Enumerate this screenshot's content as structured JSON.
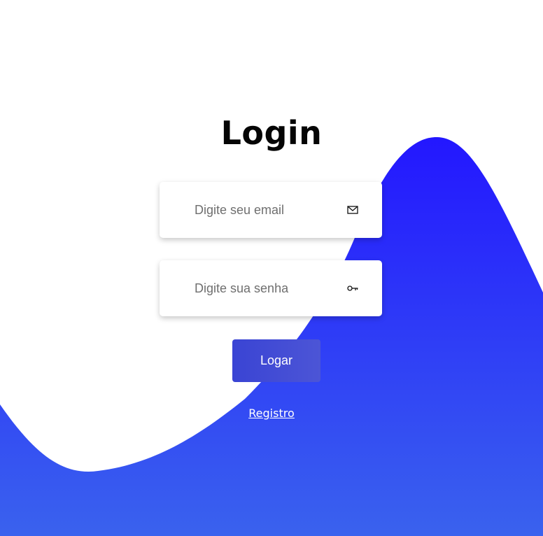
{
  "login": {
    "title": "Login",
    "email_placeholder": "Digite seu email",
    "email_icon": "mail-icon",
    "password_placeholder": "Digite sua senha",
    "password_icon": "key-icon",
    "submit_label": "Logar",
    "register_link": "Registro"
  },
  "colors": {
    "wave_top": "#2317ff",
    "wave_bottom": "#3a62ee",
    "button": "#3f48d4"
  }
}
